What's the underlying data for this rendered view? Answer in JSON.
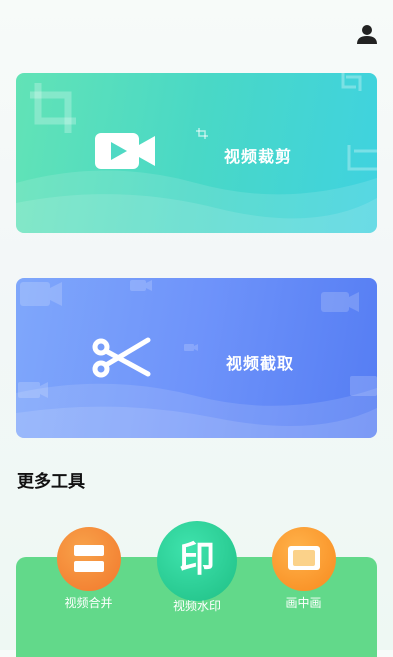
{
  "header": {
    "profile_icon": "user-icon"
  },
  "cards": [
    {
      "label": "视频裁剪",
      "icon": "video-camera-icon",
      "colors": [
        "#62e3b6",
        "#3fd2e0"
      ]
    },
    {
      "label": "视频截取",
      "icon": "scissors-icon",
      "colors": [
        "#7fa7fb",
        "#557df3"
      ]
    }
  ],
  "more_tools": {
    "title": "更多工具",
    "items": [
      {
        "label": "视频合并",
        "icon": "merge-icon",
        "color": "#f2782c"
      },
      {
        "label": "视频水印",
        "icon": "watermark-icon",
        "glyph": "印",
        "color": "#1fbf85"
      },
      {
        "label": "画中画",
        "icon": "picture-in-picture-icon",
        "color": "#f88a1e"
      }
    ]
  }
}
